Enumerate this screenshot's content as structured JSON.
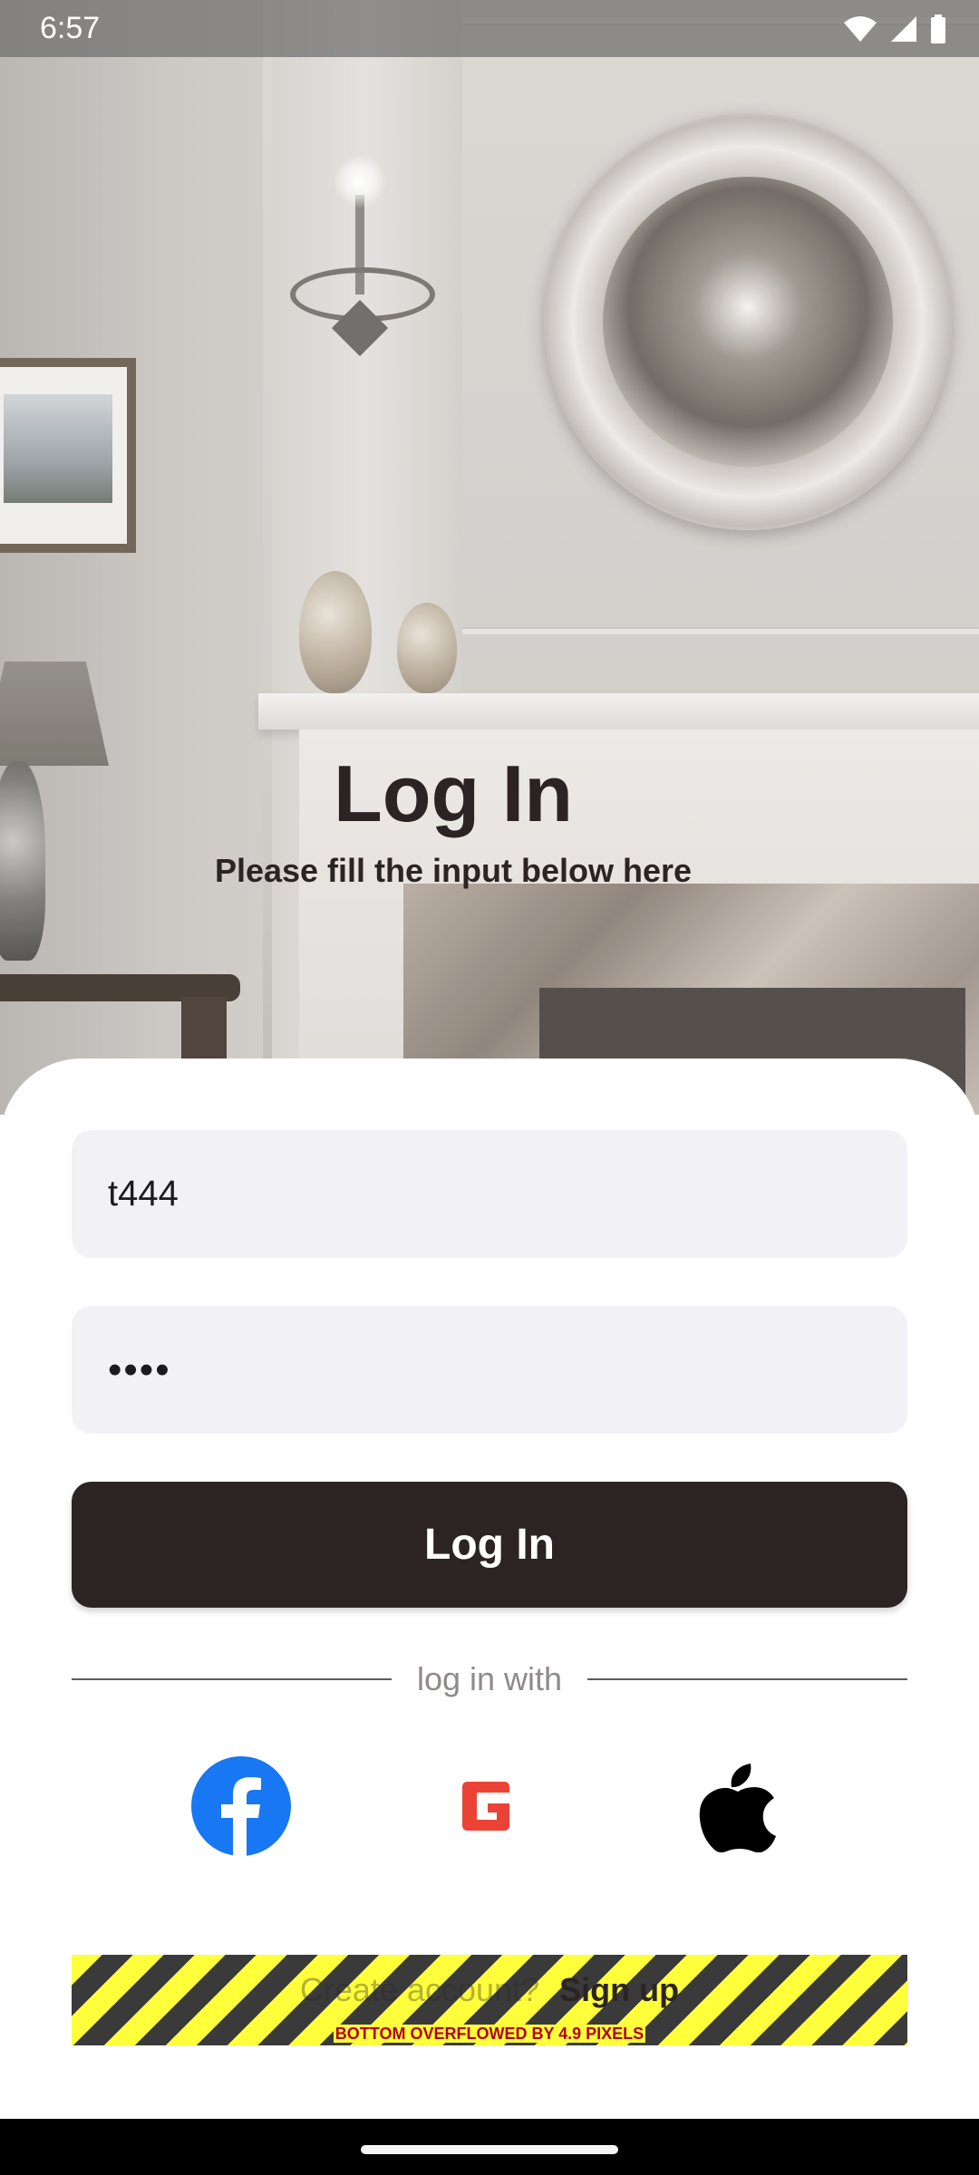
{
  "status_bar": {
    "time": "6:57",
    "icons": [
      "wifi-icon",
      "cellular-signal-icon",
      "battery-icon"
    ]
  },
  "header": {
    "title": "Log In",
    "subtitle": "Please fill the input below here"
  },
  "form": {
    "username_value": "t444",
    "password_value": "••••",
    "login_button_label": "Log In"
  },
  "social": {
    "divider_text": "log in with",
    "providers": [
      "facebook-icon",
      "google-icon",
      "apple-icon"
    ],
    "colors": {
      "facebook": "#1877F2",
      "google": "#EA4335",
      "apple": "#000000"
    }
  },
  "signup": {
    "prompt": "Create account?",
    "link_label": "Sign up"
  },
  "overflow_warning": "BOTTOM OVERFLOWED BY 4.9 PIXELS",
  "colors": {
    "primary": "#2C2424",
    "field_background": "#F2F1F6",
    "sheet_background": "#FFFFFF"
  }
}
